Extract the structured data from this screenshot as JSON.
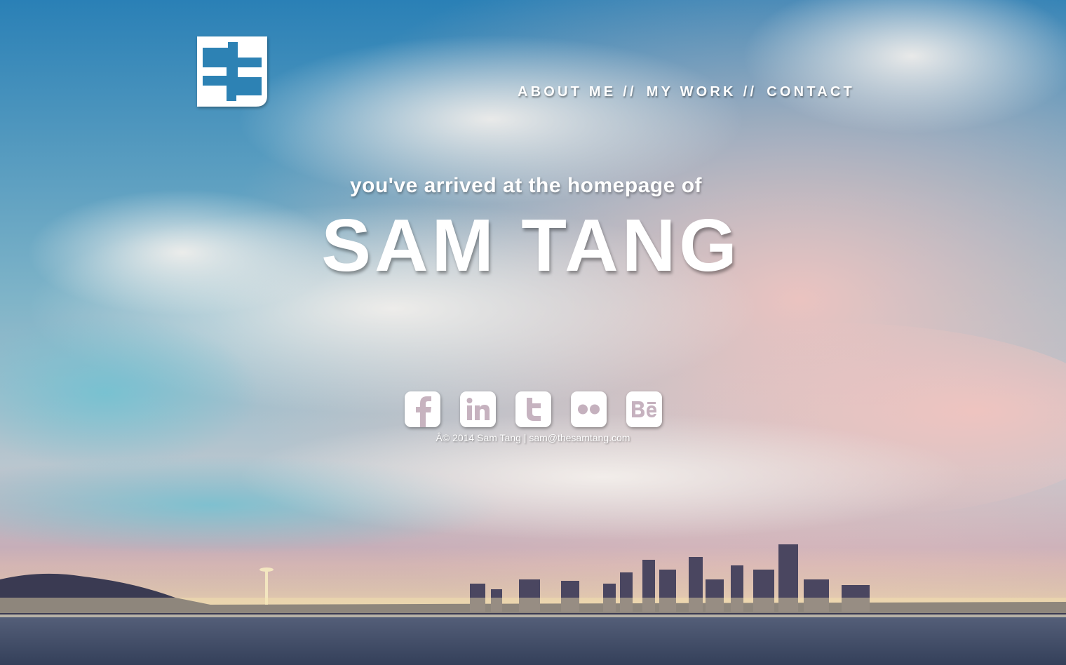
{
  "logo": {
    "letter": "S"
  },
  "nav": {
    "items": [
      {
        "label": "ABOUT ME"
      },
      {
        "label": "MY WORK"
      },
      {
        "label": "CONTACT"
      }
    ],
    "separator": "//"
  },
  "hero": {
    "tagline": "you've arrived at the homepage of",
    "name": "SAM TANG"
  },
  "social": {
    "icons": [
      {
        "icon": "facebook-icon",
        "glyph": "f"
      },
      {
        "icon": "linkedin-icon",
        "glyph": "in"
      },
      {
        "icon": "twitter-icon",
        "glyph": "t"
      },
      {
        "icon": "flickr-icon",
        "glyph": ""
      },
      {
        "icon": "behance-icon",
        "glyph": "Bē"
      }
    ]
  },
  "footer": {
    "copyright": "Â© 2014 Sam Tang | ",
    "email": "sam@thesamtang.com"
  },
  "colors": {
    "sky_top": "#2e86b8",
    "sky_pink": "#e8b8b8",
    "water": "#3e4e68",
    "text": "#ffffff"
  }
}
